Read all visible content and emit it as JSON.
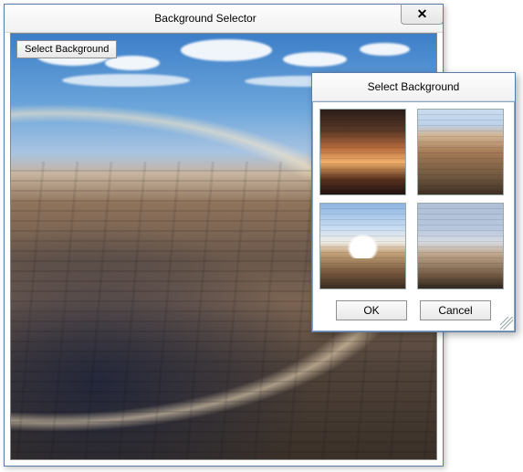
{
  "mainWindow": {
    "title": "Background Selector",
    "closeGlyph": "✕",
    "selectBackgroundButton": "Select Background"
  },
  "dialog": {
    "title": "Select Background",
    "okLabel": "OK",
    "cancelLabel": "Cancel",
    "thumbnails": [
      {
        "name": "canyon-sunset"
      },
      {
        "name": "canyon-aerial"
      },
      {
        "name": "canyon-clouds"
      },
      {
        "name": "canyon-snow"
      }
    ]
  }
}
